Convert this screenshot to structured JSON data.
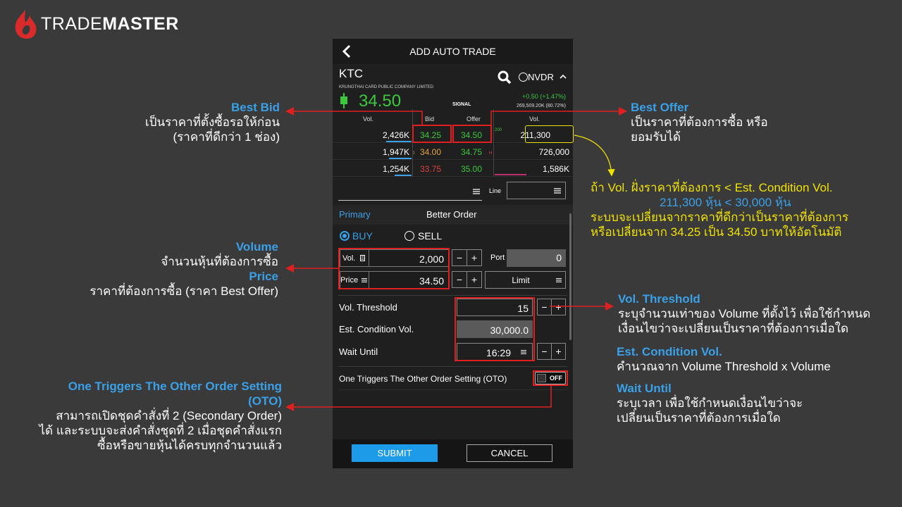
{
  "brand": {
    "name_light": "TRADE",
    "name_bold": "MASTER"
  },
  "colors": {
    "accent_blue": "#3aa0e8",
    "up_green": "#3cc83c",
    "down_red": "#e04040",
    "highlight_red": "#e02020",
    "highlight_yellow": "#f2e200"
  },
  "screen": {
    "title": "ADD AUTO TRADE",
    "symbol": "KTC",
    "company": "KRUNGTHAI CARD PUBLIC COMPANY LIMITED",
    "nvdr_label": "NVDR",
    "last_price": "34.50",
    "signal_label": "SIGNAL",
    "change": "+0.50 (+1.47%)",
    "volume_summary": "269,509.20K (80.72%)",
    "book_headers": {
      "vol_left": "Vol.",
      "bid": "Bid",
      "offer": "Offer",
      "vol_right": "Vol."
    },
    "book_rows": [
      {
        "bid_vol": "2,426K",
        "bid": "34.25",
        "offer": "34.50",
        "offer_vol": "211,300",
        "mark": "200"
      },
      {
        "bid_vol": "1,947K",
        "bid": "34.00",
        "offer": "34.75",
        "offer_vol": "726,000",
        "mark_bid": "0",
        "mark_offer": "H"
      },
      {
        "bid_vol": "1,254K",
        "bid": "33.75",
        "offer": "35.00",
        "offer_vol": "1,586K"
      }
    ],
    "line_label": "Line",
    "tabs": {
      "primary": "Primary",
      "better": "Better Order"
    },
    "side": {
      "buy": "BUY",
      "sell": "SELL"
    },
    "order": {
      "vol_label": "Vol.",
      "vol_value": "2,000",
      "price_label": "Price",
      "price_value": "34.50",
      "port_label": "Port",
      "port_value": "0",
      "price_type": "Limit",
      "minus": "−",
      "plus": "+"
    },
    "params": {
      "vol_threshold_label": "Vol. Threshold",
      "vol_threshold_value": "15",
      "est_cond_label": "Est. Condition Vol.",
      "est_cond_value": "30,000.0",
      "wait_until_label": "Wait Until",
      "wait_until_value": "16:29"
    },
    "oto_label": "One Triggers The Other Order Setting (OTO)",
    "oto_toggle": "OFF",
    "submit": "SUBMIT",
    "cancel": "CANCEL"
  },
  "annotations": {
    "best_bid": {
      "title": "Best Bid",
      "line1": "เป็นราคาที่ตั้งซื้อรอให้ก่อน",
      "line2": "(ราคาที่ดีกว่า 1 ช่อง)"
    },
    "best_offer": {
      "title": "Best Offer",
      "line1": "เป็นราคาที่ต้องการซื้อ หรือ",
      "line2": "ยอมรับได้"
    },
    "condition": {
      "line1": "ถ้า Vol. ฝั่งราคาที่ต้องการ < Est. Condition Vol.",
      "line2": "211,300 หุ้น < 30,000 หุ้น",
      "line3": "ระบบจะเปลี่ยนจากราคาที่ดีกว่าเป็นราคาที่ต้องการ",
      "line4": "หรือเปลี่ยนจาก 34.25 เป็น 34.50 บาทให้อัตโนมัติ"
    },
    "volume": {
      "title": "Volume",
      "text": "จำนวนหุ้นที่ต้องการซื้อ"
    },
    "price": {
      "title": "Price",
      "text": "ราคาที่ต้องการซื้อ (ราคา Best Offer)"
    },
    "vol_threshold": {
      "title": "Vol. Threshold",
      "line1": "ระบุจำนวนเท่าของ Volume ที่ตั้งไว้ เพื่อใช้กำหนด",
      "line2": "เงื่อนไขว่าจะเปลี่ยนเป็นราคาที่ต้องการเมื่อใด"
    },
    "est_cond": {
      "title": "Est. Condition Vol.",
      "text": "คำนวณจาก Volume Threshold x Volume"
    },
    "wait_until": {
      "title": "Wait Until",
      "line1": "ระบุเวลา เพื่อใช้กำหนดเงื่อนไขว่าจะ",
      "line2": "เปลี่ยนเป็นราคาที่ต้องการเมื่อใด"
    },
    "oto": {
      "title1": "One Triggers The Other Order Setting",
      "title2": "(OTO)",
      "line1": "สามารถเปิดชุดคำสั่งที่ 2 (Secondary Order)",
      "line2": "ได้ และระบบจะส่งคำสั่งชุดที่ 2 เมื่อชุดคำสั่งแรก",
      "line3": "ซื้อหรือขายหุ้นได้ครบทุกจำนวนแล้ว"
    }
  }
}
